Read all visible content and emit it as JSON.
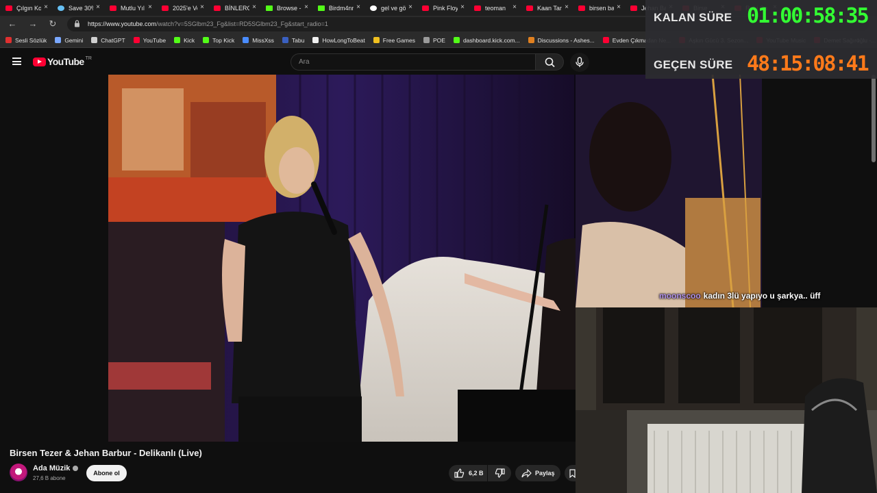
{
  "browser": {
    "tabs": [
      {
        "label": "Çılgın Ko",
        "favicon": "youtube-icon"
      },
      {
        "label": "Save 30%",
        "favicon": "steam-icon"
      },
      {
        "label": "Mutlu Yıl",
        "favicon": "youtube-icon"
      },
      {
        "label": "2025'e Vo",
        "favicon": "youtube-icon"
      },
      {
        "label": "BİNLERCE",
        "favicon": "youtube-icon"
      },
      {
        "label": "Browse -",
        "favicon": "kick-icon"
      },
      {
        "label": "Birdm4nn",
        "favicon": "kick-icon"
      },
      {
        "label": "gel ve gö",
        "favicon": "google-icon"
      },
      {
        "label": "Pink Floy",
        "favicon": "youtube-icon"
      },
      {
        "label": "teoman",
        "favicon": "youtube-icon"
      },
      {
        "label": "Kaan Tanı",
        "favicon": "youtube-icon"
      },
      {
        "label": "birsen ba",
        "favicon": "youtube-icon"
      },
      {
        "label": "Jehan Ba",
        "favicon": "youtube-icon"
      },
      {
        "label": "Birse",
        "favicon": "youtube-icon"
      },
      {
        "label": "Rubi Su",
        "favicon": "youtube-icon"
      }
    ],
    "url_domain": "https://www.youtube.com",
    "url_path": "/watch?v=5SGlbm23_Fg&list=RD5SGlbm23_Fg&start_radio=1",
    "bookmarks": [
      {
        "label": "Sesli Sözlük",
        "icon": "flag-icon"
      },
      {
        "label": "Gemini",
        "icon": "gemini-icon"
      },
      {
        "label": "ChatGPT",
        "icon": "chatgpt-icon"
      },
      {
        "label": "YouTube",
        "icon": "youtube-icon"
      },
      {
        "label": "Kick",
        "icon": "kick-icon"
      },
      {
        "label": "Top Kick",
        "icon": "kick-icon"
      },
      {
        "label": "MissXss",
        "icon": "star-icon"
      },
      {
        "label": "Tabu",
        "icon": "cp-icon"
      },
      {
        "label": "HowLongToBeat",
        "icon": "hltb-icon"
      },
      {
        "label": "Free Games",
        "icon": "tag-icon"
      },
      {
        "label": "POE",
        "icon": "folder-icon"
      },
      {
        "label": "dashboard.kick.com...",
        "icon": "kick-icon"
      },
      {
        "label": "Discussions - Ashes...",
        "icon": "fox-icon"
      },
      {
        "label": "Evden Çıkmadan Ne...",
        "icon": "youtube-icon"
      },
      {
        "label": "Aşkın Gücü 3. Sezon...",
        "icon": "youtube-icon"
      },
      {
        "label": "YouTube Music",
        "icon": "ytmusic-icon"
      },
      {
        "label": "Demet Sağıroğlu -...",
        "icon": "youtube-icon"
      }
    ],
    "bookmarks_more": "›"
  },
  "youtube": {
    "logo_text": "YouTube",
    "country_code": "TR",
    "search_placeholder": "Ara"
  },
  "video": {
    "title": "Birsen Tezer & Jehan Barbur - Delikanlı (Live)",
    "channel": "Ada Müzik",
    "subscribers": "27,6 B abone",
    "subscribe_label": "Abone ol",
    "likes": "6,2 B",
    "share_label": "Paylaş"
  },
  "stream_overlay": {
    "remaining_label": "KALAN SÜRE",
    "remaining_time": "01:00:58:35",
    "elapsed_label": "GEÇEN SÜRE",
    "elapsed_time": "48:15:08:41",
    "remaining_color": "#33ff33",
    "elapsed_color": "#ff7a1a"
  },
  "chat": {
    "username": "moonscoo",
    "message": "kadın 3lü yapıyo u şarkya.. üff",
    "username_color": "#b090e8"
  }
}
